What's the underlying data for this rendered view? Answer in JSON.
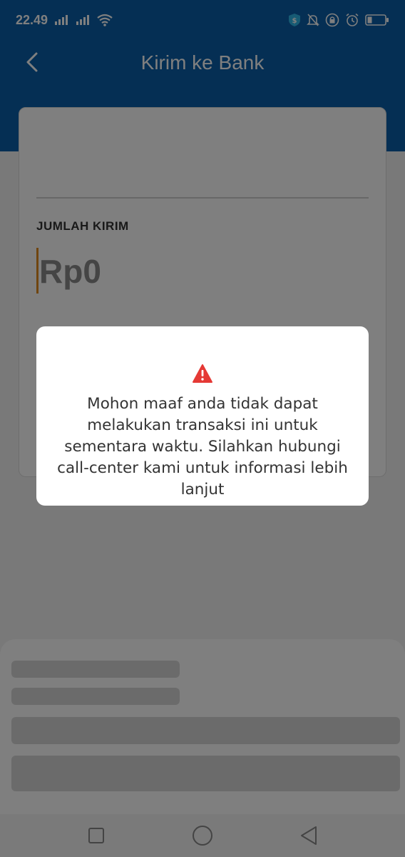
{
  "status_bar": {
    "time": "22.49",
    "icons": [
      "signal-icon",
      "signal-icon",
      "wifi-icon",
      "shield-icon",
      "bell-off-icon",
      "lock-icon",
      "alarm-icon",
      "battery-icon"
    ]
  },
  "app_bar": {
    "title": "Kirim ke Bank",
    "back_icon": "chevron-left-icon"
  },
  "form": {
    "amount_label": "JUMLAH KIRIM",
    "amount_value": "Rp0"
  },
  "dialog": {
    "icon": "warning-icon",
    "message": "Mohon maaf anda tidak dapat melakukan transaksi ini untuk sementara waktu. Silahkan hubungi call-center kami untuk informasi lebih lanjut"
  },
  "nav_bar": {
    "icons": [
      "square-recents-icon",
      "circle-home-icon",
      "triangle-back-icon"
    ]
  },
  "colors": {
    "primary": "#0b5fa8",
    "caret": "#e08a1e",
    "warning": "#e53935"
  }
}
